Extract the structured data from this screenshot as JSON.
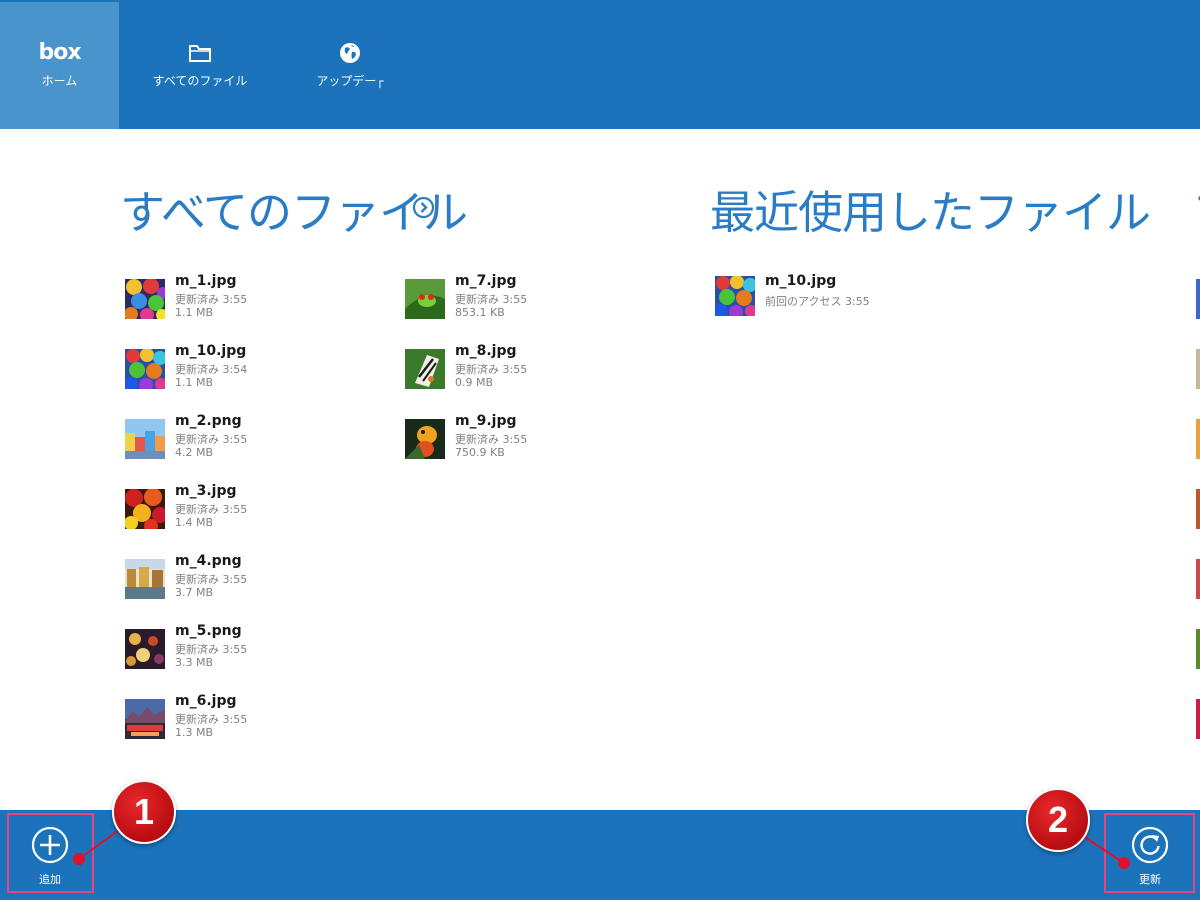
{
  "nav": {
    "home_logo": "box",
    "home_label": "ホーム",
    "files_label": "すべてのファイル",
    "updates_label": "アップデー┌"
  },
  "sections": {
    "all_files_title": "すべてのファイル",
    "recent_title": "最近使用したファイル",
    "third_peek": "フ"
  },
  "all_files": [
    {
      "name": "m_1.jpg",
      "modified": "更新済み 3:55",
      "size": "1.1 MB",
      "thumb": "umbrellas"
    },
    {
      "name": "m_10.jpg",
      "modified": "更新済み 3:54",
      "size": "1.1 MB",
      "thumb": "umbrellas-blue"
    },
    {
      "name": "m_2.png",
      "modified": "更新済み 3:55",
      "size": "4.2 MB",
      "thumb": "houses"
    },
    {
      "name": "m_3.jpg",
      "modified": "更新済み 3:55",
      "size": "1.4 MB",
      "thumb": "roses"
    },
    {
      "name": "m_4.png",
      "modified": "更新済み 3:55",
      "size": "3.7 MB",
      "thumb": "canal"
    },
    {
      "name": "m_5.png",
      "modified": "更新済み 3:55",
      "size": "3.3 MB",
      "thumb": "market"
    },
    {
      "name": "m_6.jpg",
      "modified": "更新済み 3:55",
      "size": "1.3 MB",
      "thumb": "sunset-city"
    },
    {
      "name": "m_7.jpg",
      "modified": "更新済み 3:55",
      "size": "853.1 KB",
      "thumb": "frog"
    },
    {
      "name": "m_8.jpg",
      "modified": "更新済み 3:55",
      "size": "0.9 MB",
      "thumb": "butterfly"
    },
    {
      "name": "m_9.jpg",
      "modified": "更新済み 3:55",
      "size": "750.9 KB",
      "thumb": "parrot"
    }
  ],
  "recent_files": [
    {
      "name": "m_10.jpg",
      "accessed": "前回のアクセス 3:55",
      "thumb": "umbrellas-blue"
    }
  ],
  "appbar": {
    "add_label": "追加",
    "refresh_label": "更新"
  },
  "callouts": {
    "one": "1",
    "two": "2"
  },
  "colors": {
    "accent": "#1a73bb",
    "nav_active": "#4a94cc",
    "heading": "#2a7cc4",
    "callout": "#e8457c",
    "badge": "#d0161c"
  },
  "icons": {
    "files": "folder-icon",
    "updates": "globe-icon",
    "see_all": "chevron-right-circle-icon",
    "add": "plus-circle-icon",
    "refresh": "refresh-icon"
  }
}
